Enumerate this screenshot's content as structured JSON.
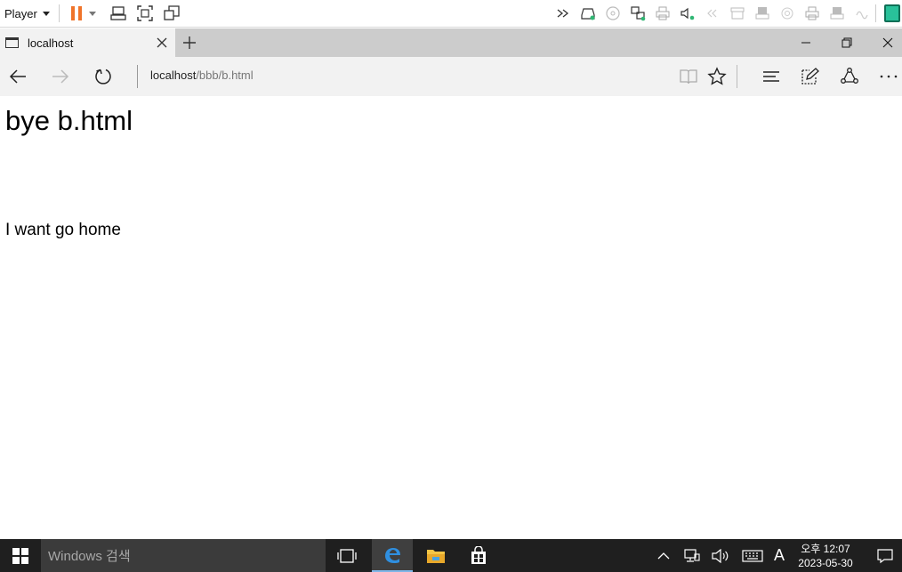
{
  "vm": {
    "player_label": "Player",
    "accent": "#f0742a"
  },
  "browser": {
    "tab_title": "localhost",
    "url_host": "localhost",
    "url_path": "/bbb/b.html"
  },
  "page": {
    "heading": "bye b.html",
    "body_text": "I want go home"
  },
  "taskbar": {
    "search_placeholder": "Windows 검색",
    "ime_label": "A",
    "time": "오후 12:07",
    "date": "2023-05-30"
  }
}
